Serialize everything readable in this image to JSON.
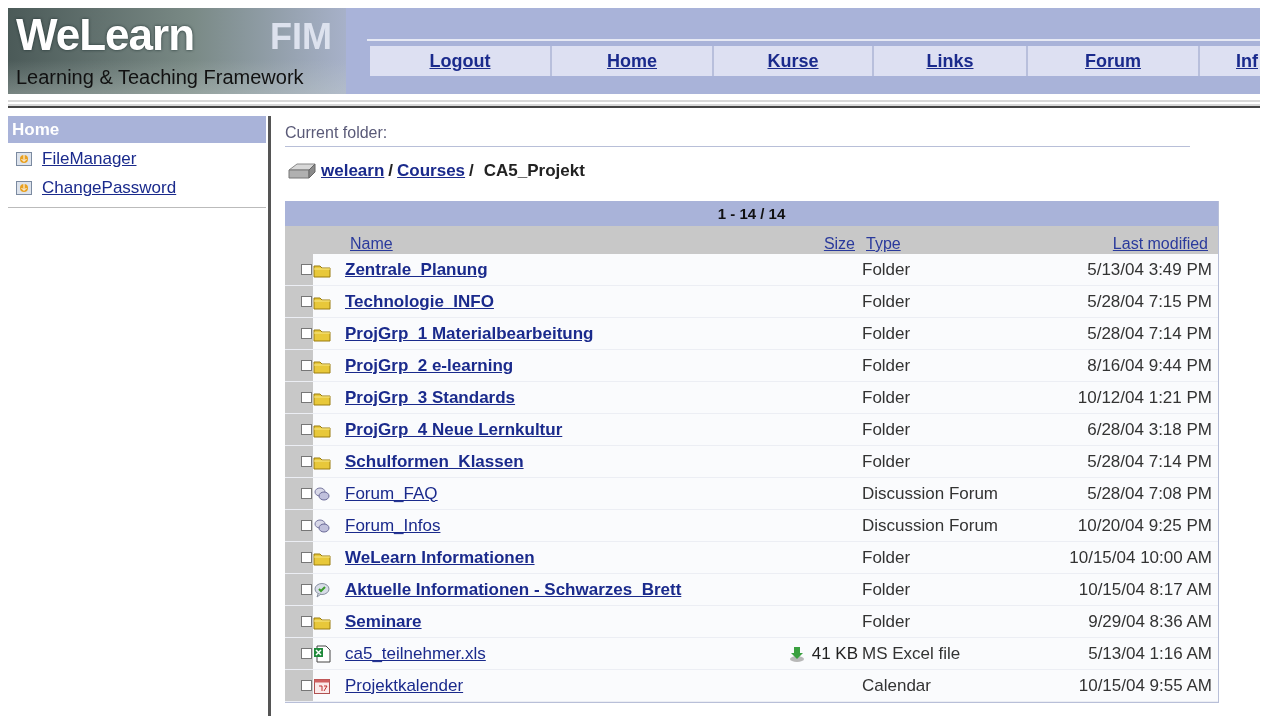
{
  "header": {
    "logo": {
      "title": "WeLearn",
      "badge": "FIM",
      "tagline": "Learning & Teaching Framework"
    },
    "nav": [
      {
        "label": "Logout"
      },
      {
        "label": "Home"
      },
      {
        "label": "Kurse"
      },
      {
        "label": "Links"
      },
      {
        "label": "Forum"
      },
      {
        "label": "Inf"
      }
    ]
  },
  "sidebar": {
    "title": "Home",
    "items": [
      {
        "label": "FileManager"
      },
      {
        "label": "ChangePassword"
      }
    ]
  },
  "main": {
    "current_folder_label": "Current folder:",
    "breadcrumb": [
      {
        "label": "welearn",
        "kind": "link",
        "separator": "/"
      },
      {
        "label": "Courses",
        "kind": "link",
        "separator": "/"
      },
      {
        "label": "CA5_Projekt",
        "kind": "current"
      }
    ],
    "table": {
      "range": "1 - 14 / 14",
      "columns": [
        "Name",
        "Size",
        "Type",
        "Last modified"
      ],
      "rows": [
        {
          "kind": "folder",
          "name": "Zentrale_Planung",
          "type": "Folder",
          "modified": "5/13/04 3:49 PM",
          "checked": false
        },
        {
          "kind": "folder",
          "name": "Technologie_INFO",
          "type": "Folder",
          "modified": "5/28/04 7:15 PM",
          "checked": false
        },
        {
          "kind": "folder",
          "name": "ProjGrp_1 Materialbearbeitung",
          "type": "Folder",
          "modified": "5/28/04 7:14 PM",
          "checked": false
        },
        {
          "kind": "folder",
          "name": "ProjGrp_2 e-learning",
          "type": "Folder",
          "modified": "8/16/04 9:44 PM",
          "checked": false
        },
        {
          "kind": "folder",
          "name": "ProjGrp_3 Standards",
          "type": "Folder",
          "modified": "10/12/04 1:21 PM",
          "checked": false
        },
        {
          "kind": "folder",
          "name": "ProjGrp_4 Neue Lernkultur",
          "type": "Folder",
          "modified": "6/28/04 3:18 PM",
          "checked": false
        },
        {
          "kind": "folder",
          "name": "Schulformen_Klassen",
          "type": "Folder",
          "modified": "5/28/04 7:14 PM",
          "checked": false
        },
        {
          "kind": "forum",
          "name": "Forum_FAQ",
          "type": "Discussion Forum",
          "modified": "5/28/04 7:08 PM",
          "checked": false
        },
        {
          "kind": "forum",
          "name": "Forum_Infos",
          "type": "Discussion Forum",
          "modified": "10/20/04 9:25 PM",
          "checked": false
        },
        {
          "kind": "folder",
          "name": "WeLearn Informationen",
          "type": "Folder",
          "modified": "10/15/04 10:00 AM",
          "checked": false
        },
        {
          "kind": "board",
          "name": "Aktuelle Informationen - Schwarzes_Brett",
          "type": "Folder",
          "modified": "10/15/04 8:17 AM",
          "checked": false
        },
        {
          "kind": "folder",
          "name": "Seminare",
          "type": "Folder",
          "modified": "9/29/04 8:36 AM",
          "checked": false
        },
        {
          "kind": "excel",
          "name": "ca5_teilnehmer.xls",
          "size": "41 KB",
          "type": "MS Excel file",
          "modified": "5/13/04 1:16 AM",
          "checked": false
        },
        {
          "kind": "calendar",
          "name": "Projektkalender",
          "type": "Calendar",
          "modified": "10/15/04 9:55 AM",
          "checked": false
        }
      ]
    }
  }
}
